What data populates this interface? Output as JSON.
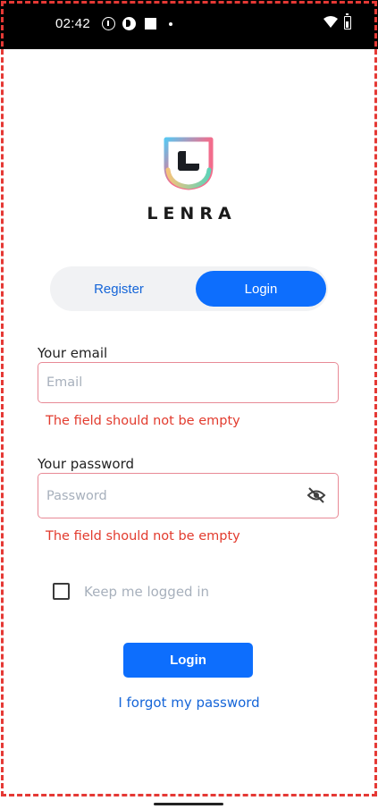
{
  "status_bar": {
    "time": "02:42",
    "icons": [
      "info-icon",
      "p-icon",
      "square-icon",
      "dot-icon",
      "wifi-icon",
      "battery-charging-icon"
    ]
  },
  "brand": {
    "name": "LENRA",
    "logo_colors": [
      "#5bc6f0",
      "#f26d8c",
      "#f6c37a",
      "#5fd3b8"
    ]
  },
  "auth_tabs": {
    "register_label": "Register",
    "login_label": "Login",
    "active": "Login"
  },
  "form": {
    "email": {
      "label": "Your email",
      "placeholder": "Email",
      "value": "",
      "error": "The field should not be empty"
    },
    "password": {
      "label": "Your password",
      "placeholder": "Password",
      "value": "",
      "error": "The field should not be empty"
    },
    "keep_logged_in": {
      "label": "Keep me logged in",
      "checked": false
    },
    "submit_label": "Login",
    "forgot_label": "I forgot my password"
  },
  "colors": {
    "accent": "#0d6efd",
    "error": "#e23b2e",
    "error_border": "#e88a96"
  }
}
